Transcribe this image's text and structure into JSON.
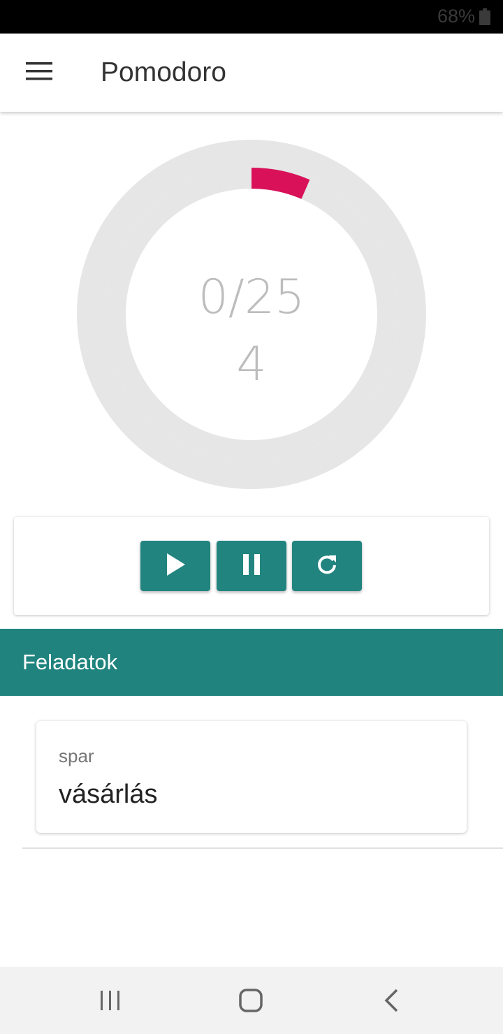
{
  "status_bar": {
    "battery_percent": "68%",
    "battery_icon": "battery-icon"
  },
  "app_bar": {
    "title": "Pomodoro",
    "menu_icon": "hamburger-menu-icon"
  },
  "timer": {
    "minutes_text": "0/25",
    "round_text": "4",
    "progress_fraction": 0.065,
    "track_color": "#e6e6e6",
    "progress_color": "#d81159"
  },
  "controls": {
    "play_icon": "play-icon",
    "pause_icon": "pause-icon",
    "reset_icon": "refresh-icon",
    "button_color": "#21847f"
  },
  "tasks": {
    "header": "Feladatok",
    "header_color": "#20837e",
    "items": [
      {
        "subtitle": "spar",
        "title": "vásárlás"
      }
    ]
  },
  "nav_bar": {
    "recents_icon": "recents-icon",
    "home_icon": "home-icon",
    "back_icon": "back-icon"
  }
}
